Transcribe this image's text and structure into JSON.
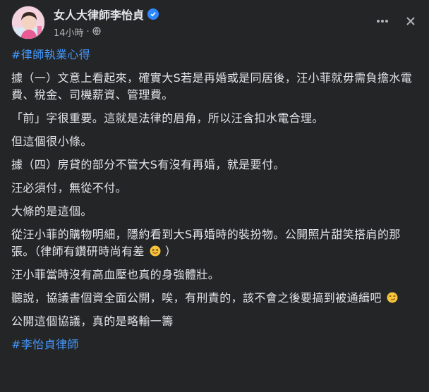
{
  "post": {
    "author": "女人大律師李怡貞",
    "timestamp": "14小時",
    "audience_icon": "globe-icon",
    "verified_icon": "verified-badge-icon",
    "more_icon": "more-horizontal-icon",
    "close_icon": "close-icon",
    "hashtag_top": "#律師執業心得",
    "paragraphs": [
      "據（一）文意上看起來，確實大S若是再婚或是同居後，汪小菲就毋需負擔水電費、稅金、司機薪資、管理費。",
      "「前」字很￼重要。這就是法律的眉角，所以汪含扣水電合理。",
      "但這個很小條。",
      "據（四）房貸的部分不管大S有沒有再婚，就是要付。",
      "汪必須付，無從不付。",
      "大條的是這個。",
      "從汪小菲的購物明細，隱約看到大S再婚時的裝扮物。公開照片甜笑搭肩的那張。（律師有鑽研時尚有差",
      "汪小菲當時沒有高血壓也真的身強體壯。",
      "聽說，協議書￼個資全面公開，唉，有刑責的￼，該不會之後要搞到被通緝吧",
      "公開這個協議，真的是略輸一籌"
    ],
    "para7_tail": "）",
    "emoji_1": "squinting-tongue-emoji",
    "emoji_2": "smirk-emoji",
    "hashtag_bottom": "#李怡貞律師"
  },
  "colors": {
    "background": "#242526",
    "text": "#e4e6eb",
    "secondary_text": "#b0b3b8",
    "link": "#4599ff",
    "verified": "#2d88ff"
  }
}
